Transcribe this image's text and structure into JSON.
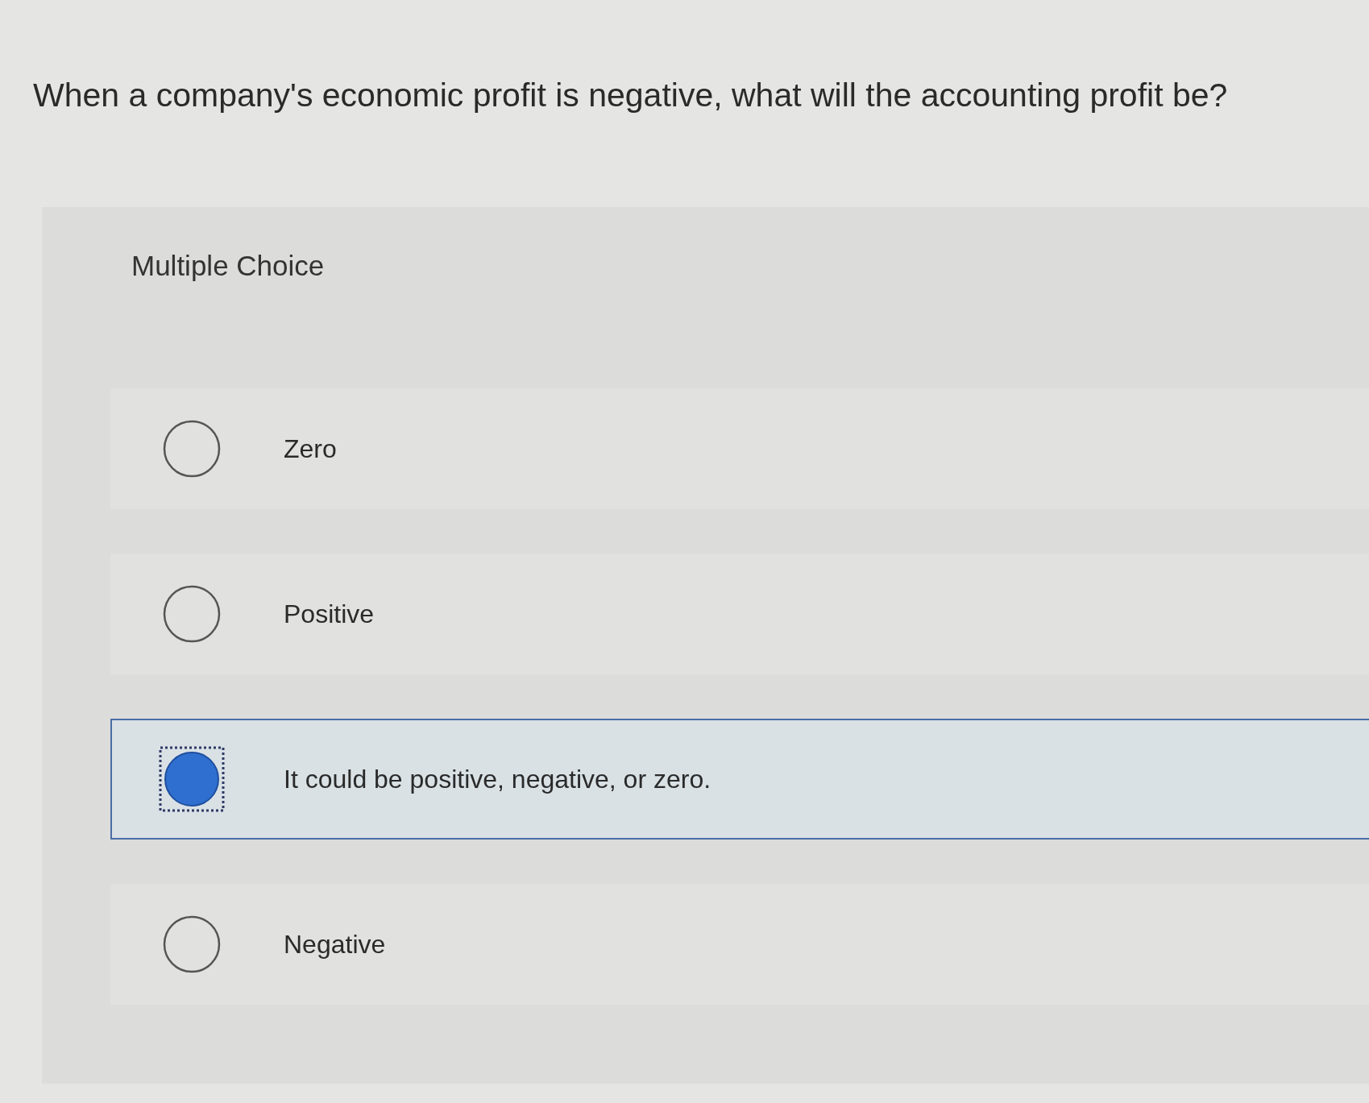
{
  "question": {
    "text": "When a company's economic profit is negative, what will the accounting profit be?"
  },
  "multiple_choice": {
    "label": "Multiple Choice",
    "options": [
      {
        "label": "Zero",
        "selected": false
      },
      {
        "label": "Positive",
        "selected": false
      },
      {
        "label": "It could be positive, negative, or zero.",
        "selected": true
      },
      {
        "label": "Negative",
        "selected": false
      }
    ]
  }
}
